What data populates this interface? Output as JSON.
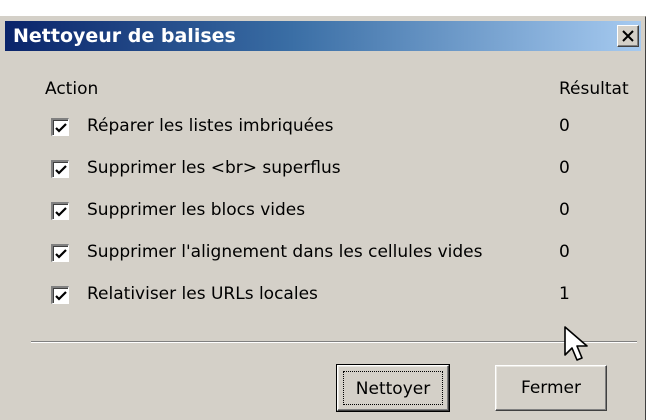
{
  "window": {
    "title": "Nettoyeur de balises",
    "close_glyph": "✕"
  },
  "table": {
    "header_action": "Action",
    "header_result": "Résultat",
    "rows": [
      {
        "label": "Réparer les listes imbriquées",
        "checked": true,
        "result": "0"
      },
      {
        "label": "Supprimer les <br> superflus",
        "checked": true,
        "result": "0"
      },
      {
        "label": "Supprimer les blocs vides",
        "checked": true,
        "result": "0"
      },
      {
        "label": "Supprimer l'alignement dans les cellules vides",
        "checked": true,
        "result": "0"
      },
      {
        "label": "Relativiser les URLs locales",
        "checked": true,
        "result": "1"
      }
    ]
  },
  "buttons": {
    "clean_label": "Nettoyer",
    "close_label": "Fermer"
  },
  "icons": {
    "checkbox": "check-icon",
    "close": "close-icon",
    "cursor": "mouse-pointer-icon"
  },
  "colors": {
    "titlebar_start": "#0a246a",
    "titlebar_end": "#a6caf0",
    "dialog_face": "#d4d0c8"
  }
}
